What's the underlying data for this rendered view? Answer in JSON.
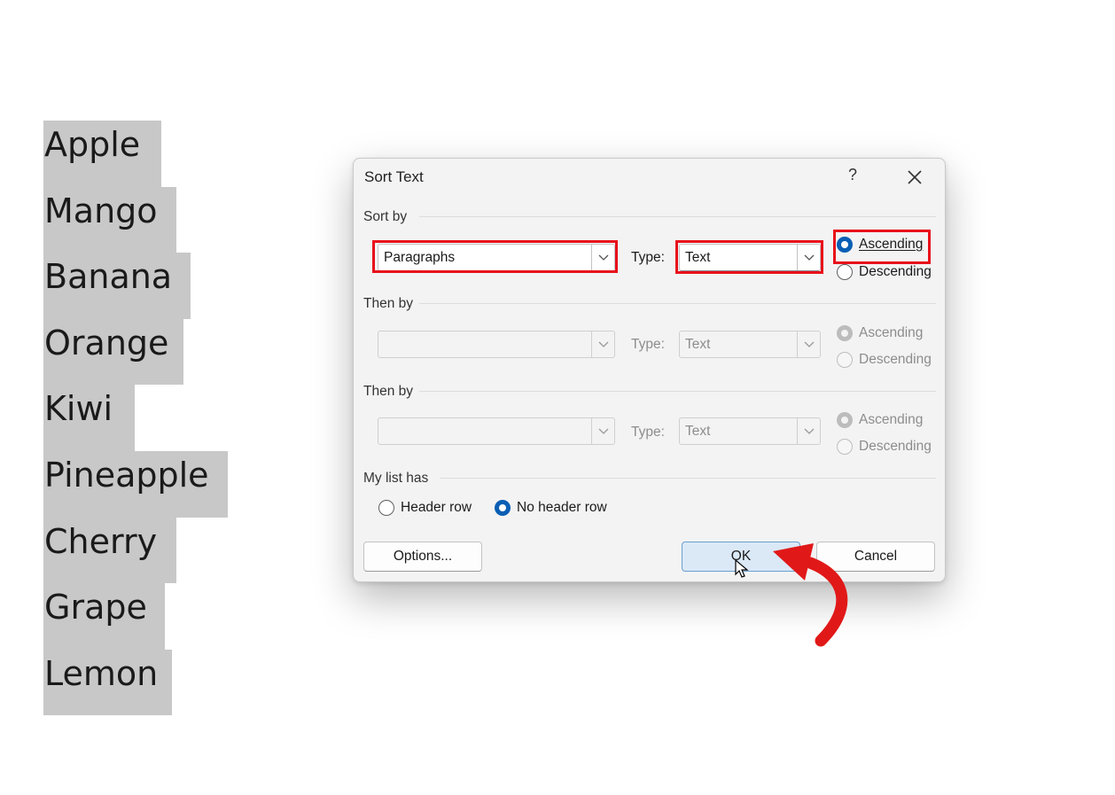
{
  "document": {
    "items": [
      "Apple",
      "Mango",
      "Banana",
      "Orange",
      "Kiwi",
      "Pineapple",
      "Cherry",
      "Grape",
      "Lemon"
    ]
  },
  "dialog": {
    "title": "Sort Text",
    "help_label": "?",
    "close_icon": "close-icon",
    "sort_by": {
      "label": "Sort by",
      "field_value": "Paragraphs",
      "type_label": "Type:",
      "type_value": "Text",
      "ascending_label": "Ascending",
      "descending_label": "Descending",
      "selected": "Ascending"
    },
    "then_by_1": {
      "label": "Then by",
      "field_value": "",
      "type_label": "Type:",
      "type_value": "Text",
      "ascending_label": "Ascending",
      "descending_label": "Descending",
      "selected": "Ascending",
      "disabled": true
    },
    "then_by_2": {
      "label": "Then by",
      "field_value": "",
      "type_label": "Type:",
      "type_value": "Text",
      "ascending_label": "Ascending",
      "descending_label": "Descending",
      "selected": "Ascending",
      "disabled": true
    },
    "list_has": {
      "label": "My list has",
      "header_row_label": "Header row",
      "no_header_row_label": "No header row",
      "selected": "No header row"
    },
    "buttons": {
      "options_label": "Options...",
      "ok_label": "OK",
      "cancel_label": "Cancel"
    }
  },
  "colors": {
    "highlight": "#e8101a",
    "accent": "#0a5fb4",
    "selection": "#c8c8c8"
  }
}
